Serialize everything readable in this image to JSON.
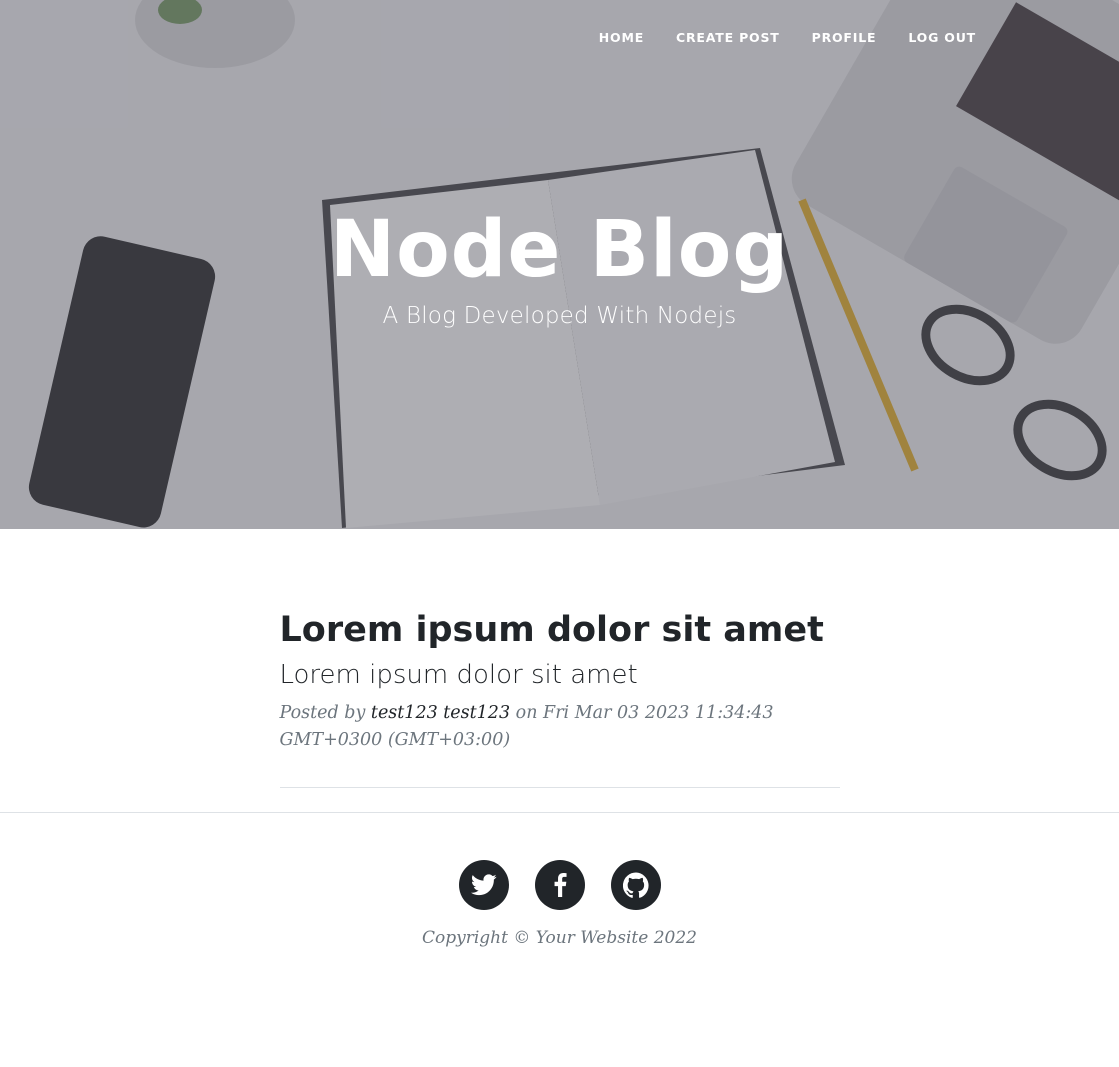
{
  "nav": {
    "items": [
      {
        "label": "HOME"
      },
      {
        "label": "CREATE POST"
      },
      {
        "label": "PROFILE"
      },
      {
        "label": "LOG OUT"
      }
    ]
  },
  "hero": {
    "title": "Node Blog",
    "subtitle": "A Blog Developed With Nodejs"
  },
  "post": {
    "title": "Lorem ipsum dolor sit amet",
    "subtitle": "Lorem ipsum dolor sit amet",
    "meta_prefix": "Posted by",
    "author": "test123 test123",
    "meta_on": "on",
    "date": "Fri Mar 03 2023 11:34:43 GMT+0300 (GMT+03:00)"
  },
  "footer": {
    "social": [
      {
        "icon": "twitter-icon"
      },
      {
        "icon": "facebook-icon"
      },
      {
        "icon": "github-icon"
      }
    ],
    "copyright": "Copyright © Your Website 2022"
  },
  "colors": {
    "dark": "#212529",
    "muted": "#6c757d",
    "divider": "#dee2e6"
  }
}
